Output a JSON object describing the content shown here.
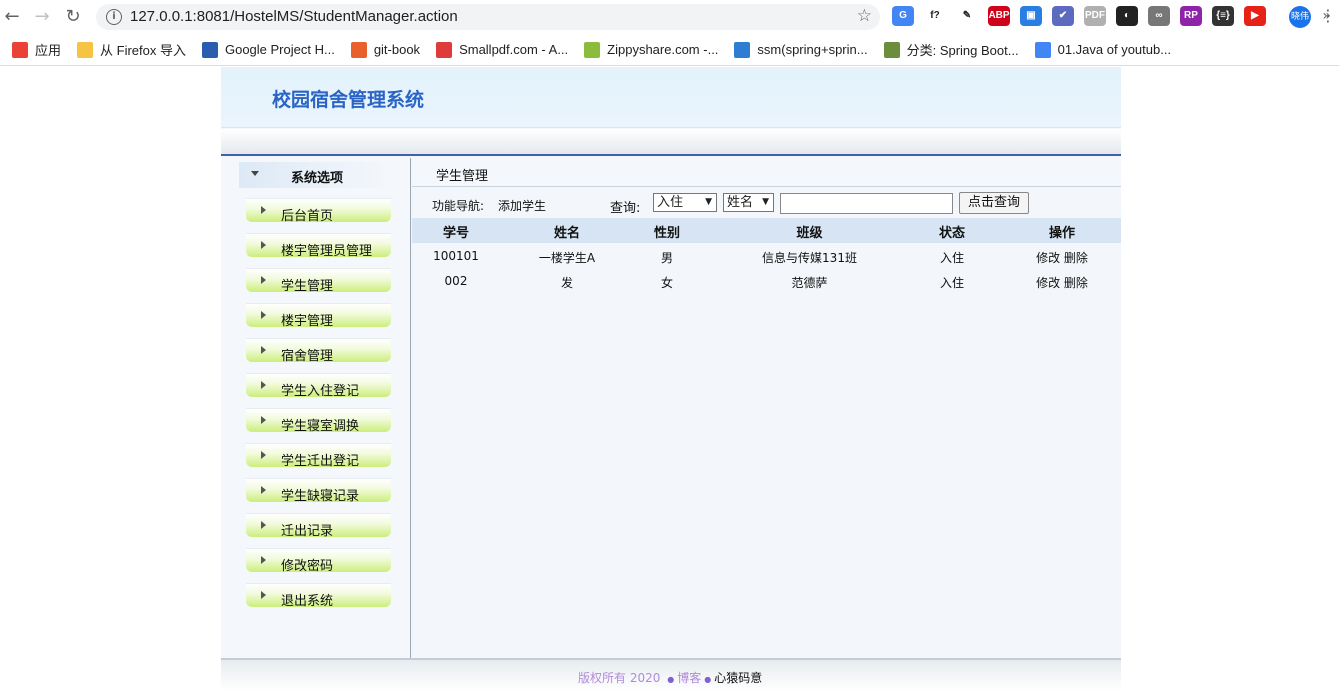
{
  "browser": {
    "url": "127.0.0.1:8081/HostelMS/StudentManager.action",
    "extensions": [
      {
        "name": "translate-icon",
        "glyph": "G",
        "color": "#4285f4"
      },
      {
        "name": "font-icon",
        "glyph": "f?",
        "color": "#ffffff"
      },
      {
        "name": "eyedropper-icon",
        "glyph": "✎",
        "color": "#ffffff"
      },
      {
        "name": "adblock-icon",
        "glyph": "ABP",
        "color": "#d0021b"
      },
      {
        "name": "tampermonkey-icon",
        "glyph": "▣",
        "color": "#2a7de1"
      },
      {
        "name": "checkmark-icon",
        "glyph": "✔",
        "color": "#5c6bc0"
      },
      {
        "name": "pdf-icon",
        "glyph": "PDF",
        "color": "#b0b0b0"
      },
      {
        "name": "mask-icon",
        "glyph": "◐",
        "color": "#222222"
      },
      {
        "name": "bike-icon",
        "glyph": "∞",
        "color": "#777777"
      },
      {
        "name": "rp-icon",
        "glyph": "RP",
        "color": "#8e24aa"
      },
      {
        "name": "json-icon",
        "glyph": "{≡}",
        "color": "#333333"
      },
      {
        "name": "youtube-icon",
        "glyph": "▶",
        "color": "#e62117"
      }
    ],
    "profile": "晓伟"
  },
  "bookmarks": [
    {
      "label": "应用",
      "color": "#ea4335"
    },
    {
      "label": "从 Firefox 导入",
      "color": "#f6c344"
    },
    {
      "label": "Google Project H...",
      "color": "#2a5db0"
    },
    {
      "label": "git-book",
      "color": "#e8602c"
    },
    {
      "label": "Smallpdf.com - A...",
      "color": "#e03b3b"
    },
    {
      "label": "Zippyshare.com -...",
      "color": "#8dbb3c"
    },
    {
      "label": "ssm(spring+sprin...",
      "color": "#2d7dd2"
    },
    {
      "label": "分类: Spring Boot...",
      "color": "#6a8e3a"
    },
    {
      "label": "01.Java of youtub...",
      "color": "#4285f4"
    }
  ],
  "app": {
    "title": "校园宿舍管理系统",
    "sidebar_title": "系统选项",
    "menu": [
      "后台首页",
      "楼宇管理员管理",
      "学生管理",
      "楼宇管理",
      "宿舍管理",
      "学生入住登记",
      "学生寝室调换",
      "学生迁出登记",
      "学生缺寝记录",
      "迁出记录",
      "修改密码",
      "退出系统"
    ],
    "main_title": "学生管理",
    "toolbar": {
      "nav_label": "功能导航:",
      "add_link": "添加学生",
      "query_label": "查询:",
      "status_select": "入住",
      "field_select": "姓名",
      "search_value": "",
      "search_button": "点击查询"
    },
    "table": {
      "headers": [
        "学号",
        "姓名",
        "性别",
        "班级",
        "状态",
        "操作"
      ],
      "rows": [
        [
          "100101",
          "一楼学生A",
          "男",
          "信息与传媒131班",
          "入住"
        ],
        [
          "002",
          "发",
          "女",
          "范德萨",
          "入住"
        ]
      ],
      "edit_label": "修改",
      "delete_label": "删除"
    },
    "footer": {
      "copyright": "版权所有",
      "year": "2020",
      "blog": "博客",
      "author": "心猿码意"
    }
  }
}
